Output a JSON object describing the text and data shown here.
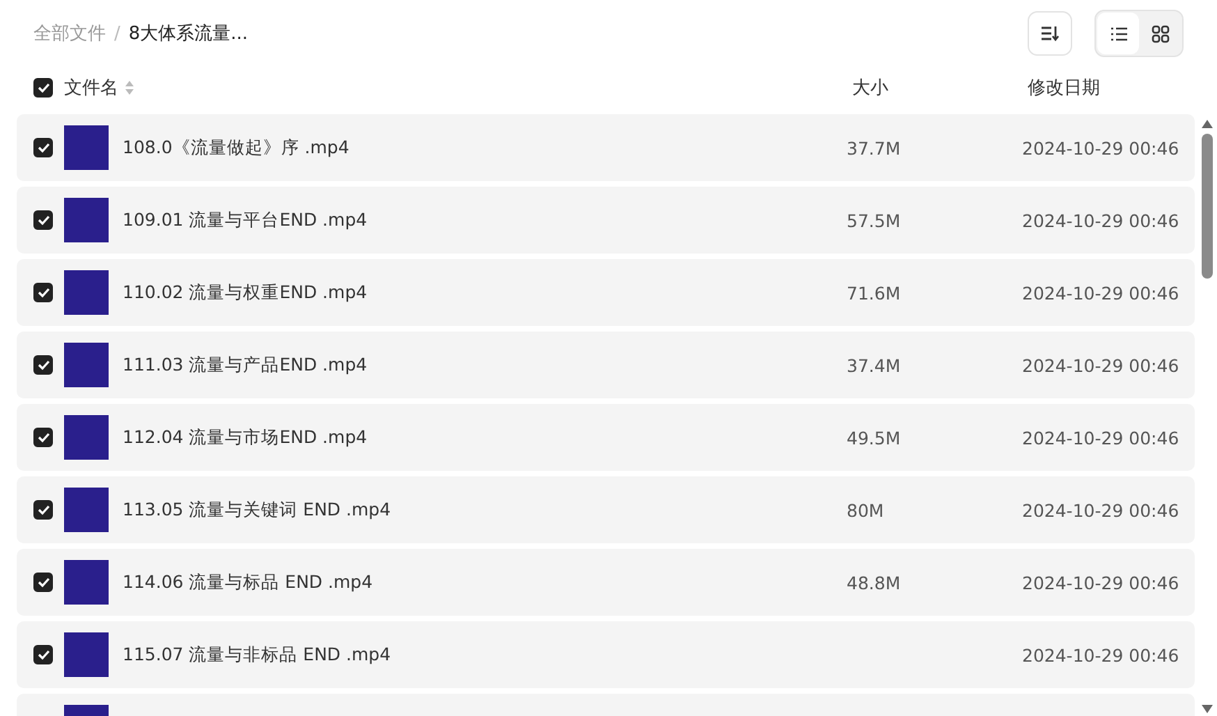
{
  "breadcrumb": [
    {
      "label": "全部文件",
      "current": false
    },
    {
      "label": "8大体系流量...",
      "current": true
    }
  ],
  "separator": "/",
  "view_toggle": [
    {
      "kind": "list",
      "selected": true
    },
    {
      "kind": "grid",
      "selected": false
    }
  ],
  "table": {
    "select_all": {
      "checked": true
    },
    "columns": [
      "文件名",
      "大小",
      "修改日期"
    ],
    "rows": [
      {
        "checked": true,
        "name": "108.0《流量做起》序 .mp4",
        "size": "37.7M",
        "date": "2024-10-29 00:46"
      },
      {
        "checked": true,
        "name": "109.01 流量与平台END .mp4",
        "size": "57.5M",
        "date": "2024-10-29 00:46"
      },
      {
        "checked": true,
        "name": "110.02 流量与权重END .mp4",
        "size": "71.6M",
        "date": "2024-10-29 00:46"
      },
      {
        "checked": true,
        "name": "111.03 流量与产品END .mp4",
        "size": "37.4M",
        "date": "2024-10-29 00:46"
      },
      {
        "checked": true,
        "name": "112.04 流量与市场END .mp4",
        "size": "49.5M",
        "date": "2024-10-29 00:46"
      },
      {
        "checked": true,
        "name": "113.05 流量与关键词 END .mp4",
        "size": "80M",
        "date": "2024-10-29 00:46"
      },
      {
        "checked": true,
        "name": "114.06 流量与标品 END .mp4",
        "size": "48.8M",
        "date": "2024-10-29 00:46"
      },
      {
        "checked": true,
        "name": "115.07 流量与非标品 END .mp4",
        "date": "2024-10-29 00:46"
      }
    ]
  }
}
